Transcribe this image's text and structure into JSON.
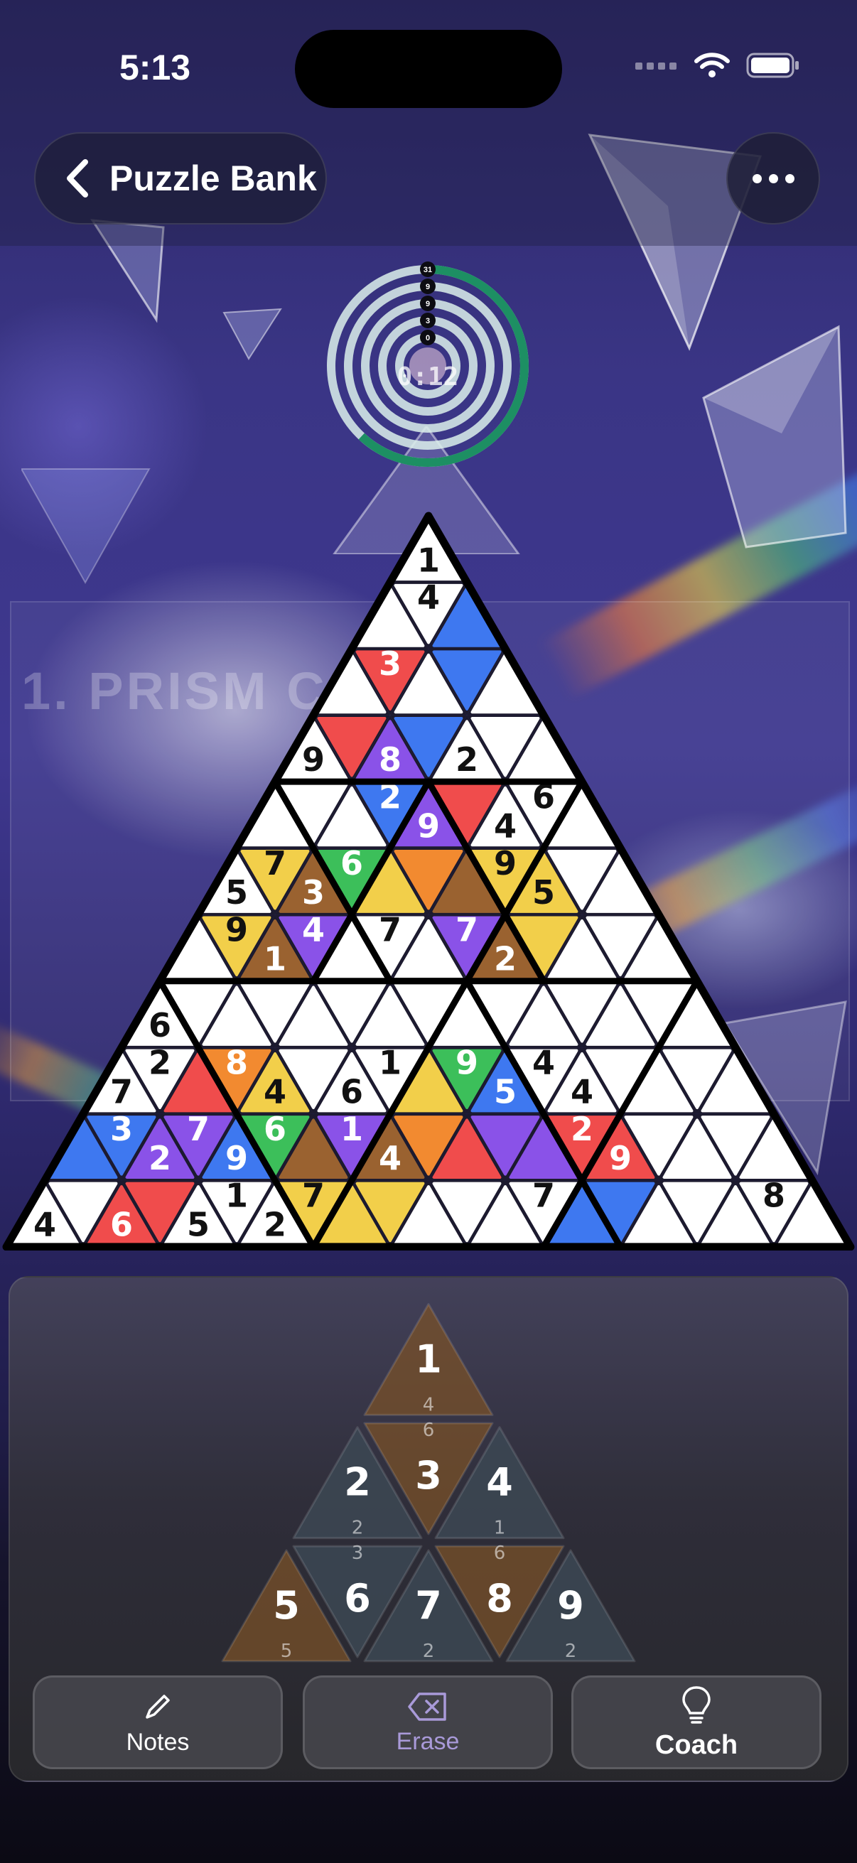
{
  "status_bar": {
    "time": "5:13"
  },
  "nav": {
    "back_label": "Puzzle Bank"
  },
  "banner": {
    "text": "1. PRISM CORE"
  },
  "timer": {
    "text": "0:12",
    "rings": [
      "31",
      "9",
      "9",
      "3",
      "0"
    ]
  },
  "colors": {
    "red": "#f04c4c",
    "blue": "#3e78f0",
    "purple": "#8a52e8",
    "green": "#3cbf5a",
    "yellow": "#f2cf4a",
    "brown": "#9a6230",
    "orange": "#f28a30",
    "white": "#ffffff"
  },
  "board": {
    "rows": [
      [
        {
          "c": "white",
          "n": "1"
        }
      ],
      [
        {
          "c": "white",
          "n": ""
        },
        {
          "c": "white",
          "n": "4"
        },
        {
          "c": "blue",
          "n": ""
        }
      ],
      [
        {
          "c": "white",
          "n": ""
        },
        {
          "c": "red",
          "n": "3"
        },
        {
          "c": "white",
          "n": ""
        },
        {
          "c": "blue",
          "n": ""
        },
        {
          "c": "white",
          "n": ""
        }
      ],
      [
        {
          "c": "white",
          "n": "9"
        },
        {
          "c": "red",
          "n": ""
        },
        {
          "c": "purple",
          "n": "8"
        },
        {
          "c": "blue",
          "n": ""
        },
        {
          "c": "white",
          "n": "2"
        },
        {
          "c": "white",
          "n": ""
        },
        {
          "c": "white",
          "n": ""
        }
      ],
      [
        {
          "c": "white",
          "n": ""
        },
        {
          "c": "white",
          "n": ""
        },
        {
          "c": "white",
          "n": ""
        },
        {
          "c": "blue",
          "n": "2"
        },
        {
          "c": "purple",
          "n": "9"
        },
        {
          "c": "red",
          "n": ""
        },
        {
          "c": "white",
          "n": "4"
        },
        {
          "c": "white",
          "n": "6"
        },
        {
          "c": "white",
          "n": ""
        }
      ],
      [
        {
          "c": "white",
          "n": "5"
        },
        {
          "c": "yellow",
          "n": "7"
        },
        {
          "c": "brown",
          "n": "3"
        },
        {
          "c": "green",
          "n": "6"
        },
        {
          "c": "yellow",
          "n": ""
        },
        {
          "c": "orange",
          "n": ""
        },
        {
          "c": "brown",
          "n": ""
        },
        {
          "c": "yellow",
          "n": "9"
        },
        {
          "c": "yellow",
          "n": "5"
        },
        {
          "c": "white",
          "n": ""
        },
        {
          "c": "white",
          "n": ""
        }
      ],
      [
        {
          "c": "white",
          "n": ""
        },
        {
          "c": "yellow",
          "n": "9"
        },
        {
          "c": "brown",
          "n": "1"
        },
        {
          "c": "purple",
          "n": "4"
        },
        {
          "c": "white",
          "n": ""
        },
        {
          "c": "white",
          "n": "7"
        },
        {
          "c": "white",
          "n": ""
        },
        {
          "c": "purple",
          "n": "7"
        },
        {
          "c": "brown",
          "n": "2"
        },
        {
          "c": "yellow",
          "n": ""
        },
        {
          "c": "white",
          "n": ""
        },
        {
          "c": "white",
          "n": ""
        },
        {
          "c": "white",
          "n": ""
        }
      ],
      [
        {
          "c": "white",
          "n": "6"
        },
        {
          "c": "white",
          "n": ""
        },
        {
          "c": "white",
          "n": ""
        },
        {
          "c": "white",
          "n": ""
        },
        {
          "c": "white",
          "n": ""
        },
        {
          "c": "white",
          "n": ""
        },
        {
          "c": "white",
          "n": ""
        },
        {
          "c": "white",
          "n": ""
        },
        {
          "c": "white",
          "n": ""
        },
        {
          "c": "white",
          "n": ""
        },
        {
          "c": "white",
          "n": ""
        },
        {
          "c": "white",
          "n": ""
        },
        {
          "c": "white",
          "n": ""
        },
        {
          "c": "white",
          "n": ""
        },
        {
          "c": "white",
          "n": ""
        }
      ],
      [
        {
          "c": "white",
          "n": "7"
        },
        {
          "c": "white",
          "n": "2"
        },
        {
          "c": "red",
          "n": ""
        },
        {
          "c": "orange",
          "n": "8"
        },
        {
          "c": "yellow",
          "n": "4"
        },
        {
          "c": "white",
          "n": ""
        },
        {
          "c": "white",
          "n": "6"
        },
        {
          "c": "white",
          "n": "1"
        },
        {
          "c": "yellow",
          "n": ""
        },
        {
          "c": "green",
          "n": "9"
        },
        {
          "c": "blue",
          "n": "5"
        },
        {
          "c": "white",
          "n": "4"
        },
        {
          "c": "white",
          "n": "4"
        },
        {
          "c": "white",
          "n": ""
        },
        {
          "c": "white",
          "n": ""
        },
        {
          "c": "white",
          "n": ""
        },
        {
          "c": "white",
          "n": ""
        }
      ],
      [
        {
          "c": "blue",
          "n": ""
        },
        {
          "c": "blue",
          "n": "3"
        },
        {
          "c": "purple",
          "n": "2"
        },
        {
          "c": "purple",
          "n": "7"
        },
        {
          "c": "blue",
          "n": "9"
        },
        {
          "c": "green",
          "n": "6"
        },
        {
          "c": "brown",
          "n": ""
        },
        {
          "c": "purple",
          "n": "1"
        },
        {
          "c": "brown",
          "n": "4"
        },
        {
          "c": "orange",
          "n": ""
        },
        {
          "c": "red",
          "n": ""
        },
        {
          "c": "purple",
          "n": ""
        },
        {
          "c": "purple",
          "n": ""
        },
        {
          "c": "red",
          "n": "2"
        },
        {
          "c": "red",
          "n": "9"
        },
        {
          "c": "white",
          "n": ""
        },
        {
          "c": "white",
          "n": ""
        },
        {
          "c": "white",
          "n": ""
        },
        {
          "c": "white",
          "n": ""
        }
      ],
      [
        {
          "c": "white",
          "n": "4"
        },
        {
          "c": "white",
          "n": ""
        },
        {
          "c": "red",
          "n": "6"
        },
        {
          "c": "red",
          "n": ""
        },
        {
          "c": "white",
          "n": "5"
        },
        {
          "c": "white",
          "n": "1"
        },
        {
          "c": "white",
          "n": "2"
        },
        {
          "c": "yellow",
          "n": "7"
        },
        {
          "c": "yellow",
          "n": ""
        },
        {
          "c": "yellow",
          "n": ""
        },
        {
          "c": "white",
          "n": ""
        },
        {
          "c": "white",
          "n": ""
        },
        {
          "c": "white",
          "n": ""
        },
        {
          "c": "white",
          "n": "7"
        },
        {
          "c": "blue",
          "n": ""
        },
        {
          "c": "blue",
          "n": ""
        },
        {
          "c": "white",
          "n": ""
        },
        {
          "c": "white",
          "n": ""
        },
        {
          "c": "white",
          "n": ""
        },
        {
          "c": "white",
          "n": "8"
        },
        {
          "c": "white",
          "n": ""
        }
      ]
    ]
  },
  "keypad": [
    {
      "digit": "1",
      "count": "4",
      "color": "brown"
    },
    {
      "digit": "2",
      "count": "2",
      "color": "slate"
    },
    {
      "digit": "3",
      "count": "6",
      "color": "brown"
    },
    {
      "digit": "4",
      "count": "1",
      "color": "slate"
    },
    {
      "digit": "5",
      "count": "5",
      "color": "brown"
    },
    {
      "digit": "6",
      "count": "3",
      "color": "slate"
    },
    {
      "digit": "7",
      "count": "2",
      "color": "slate"
    },
    {
      "digit": "8",
      "count": "6",
      "color": "brown"
    },
    {
      "digit": "9",
      "count": "2",
      "color": "slate"
    }
  ],
  "buttons": {
    "notes": "Notes",
    "erase": "Erase",
    "coach": "Coach"
  }
}
